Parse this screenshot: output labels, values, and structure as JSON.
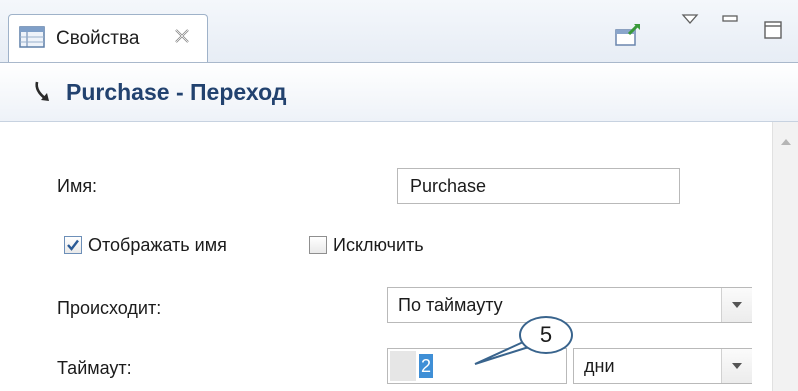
{
  "tab": {
    "title": "Свойства"
  },
  "header": {
    "title": "Purchase - Переход"
  },
  "form": {
    "name_label": "Имя:",
    "name_value": "Purchase",
    "show_name_label": "Отображать имя",
    "show_name_checked": true,
    "exclude_label": "Исключить",
    "exclude_checked": false,
    "occurs_label": "Происходит:",
    "occurs_value": "По таймауту",
    "timeout_label": "Таймаут:",
    "timeout_value": "2",
    "timeout_unit": "дни"
  },
  "callout": {
    "number": "5"
  },
  "icons": {
    "tab": "properties-grid-icon",
    "close": "close-tab-icon",
    "pin": "pin-to-view-icon",
    "menu": "view-menu-icon",
    "minimize": "minimize-icon",
    "maximize": "maximize-icon",
    "header": "transition-arrow-icon"
  },
  "colors": {
    "header_title": "#22426f",
    "selection": "#3f8fd6",
    "callout_border": "#39648d"
  }
}
